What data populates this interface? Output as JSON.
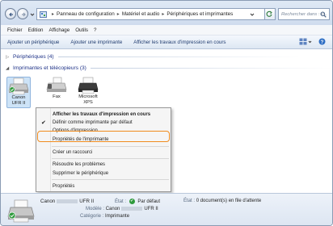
{
  "address": {
    "crumbs": [
      "Panneau de configuration",
      "Matériel et audio",
      "Périphériques et imprimantes"
    ],
    "separator": "▸",
    "search_placeholder": "Rechercher dans : P..."
  },
  "menubar": [
    "Fichier",
    "Edition",
    "Affichage",
    "Outils",
    "?"
  ],
  "commands": {
    "add_device": "Ajouter un périphérique",
    "add_printer": "Ajouter une imprimante",
    "see_jobs": "Afficher les travaux d'impression en cours"
  },
  "groups": {
    "devices": "Périphériques (4)",
    "printers": "Imprimantes et télécopieurs (3)"
  },
  "devices": [
    {
      "label_line1": "Canon",
      "label_line2": "UFR II"
    },
    {
      "label_line1": "Fax",
      "label_line2": ""
    },
    {
      "label_line1": "Microsoft",
      "label_line2": "XPS"
    }
  ],
  "context_menu": {
    "items": [
      "Afficher les travaux d'impression en cours",
      "Définir comme imprimante par défaut",
      "Options d'impression",
      "Propriétés de l'imprimante",
      "Créer un raccourci",
      "Résoudre les problèmes",
      "Supprimer le périphérique",
      "Propriétés"
    ]
  },
  "details": {
    "name_prefix": "Canon",
    "name_suffix": "UFR II",
    "state_label": "État :",
    "state_value": "Par défaut",
    "state2_label": "État :",
    "state2_value": "0 document(s) en file d'attente",
    "model_label": "Modèle :",
    "model_prefix": "Canon",
    "model_suffix": "UFR II",
    "category_label": "Catégorie :",
    "category_value": "Imprimante"
  }
}
